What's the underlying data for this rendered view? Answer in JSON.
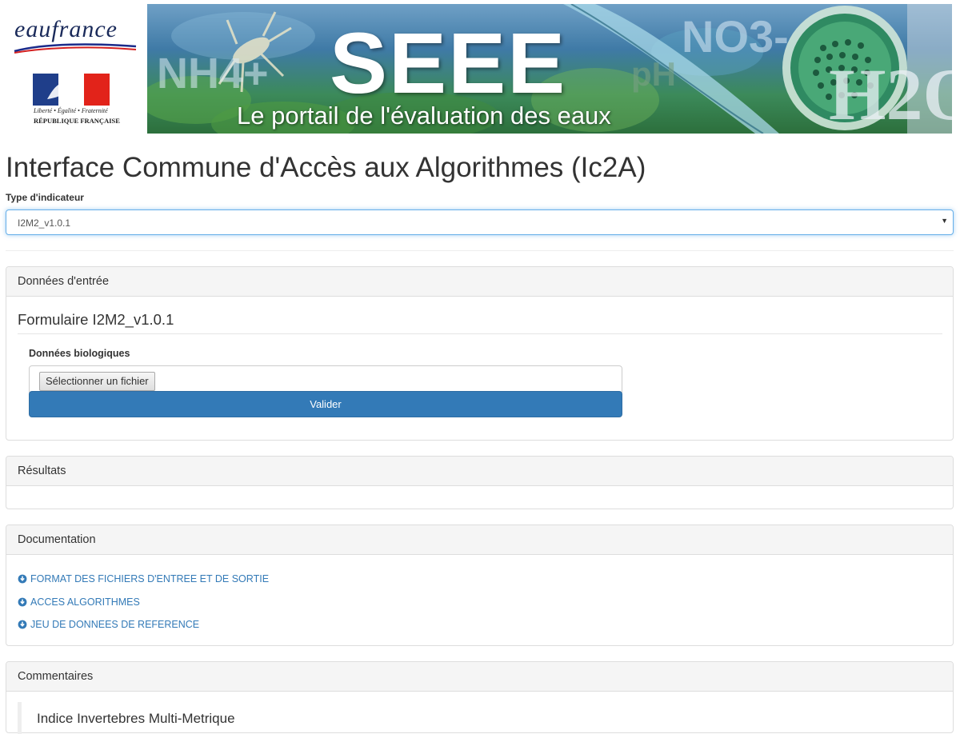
{
  "header": {
    "eaufrance_logo": "eaufrance",
    "republique_devise": "Liberté • Égalité • Fraternité",
    "republique_name": "RÉPUBLIQUE FRANÇAISE",
    "banner_title": "SEEE",
    "banner_subtitle": "Le portail de l'évaluation des eaux",
    "banner_chem": {
      "nh4": "NH4+",
      "no3": "NO3-",
      "ph": "pH",
      "h2o": "H2O"
    }
  },
  "page": {
    "title": "Interface Commune d'Accès aux Algorithmes (Ic2A)",
    "indicator_label": "Type d'indicateur",
    "indicator_value": "I2M2_v1.0.1"
  },
  "entree": {
    "heading": "Données d'entrée",
    "form_title": "Formulaire I2M2_v1.0.1",
    "bio_label": "Données biologiques",
    "file_button": "Sélectionner un fichier",
    "submit": "Valider"
  },
  "resultats": {
    "heading": "Résultats"
  },
  "documentation": {
    "heading": "Documentation",
    "links": [
      {
        "label": "FORMAT DES FICHIERS D'ENTREE ET DE SORTIE"
      },
      {
        "label": "ACCES ALGORITHMES"
      },
      {
        "label": "JEU DE DONNEES DE REFERENCE"
      }
    ]
  },
  "commentaires": {
    "heading": "Commentaires",
    "text": "Indice Invertebres Multi-Metrique"
  },
  "colors": {
    "primary": "#337ab7",
    "link": "#337ab7",
    "panel_heading_bg": "#f5f5f5"
  }
}
